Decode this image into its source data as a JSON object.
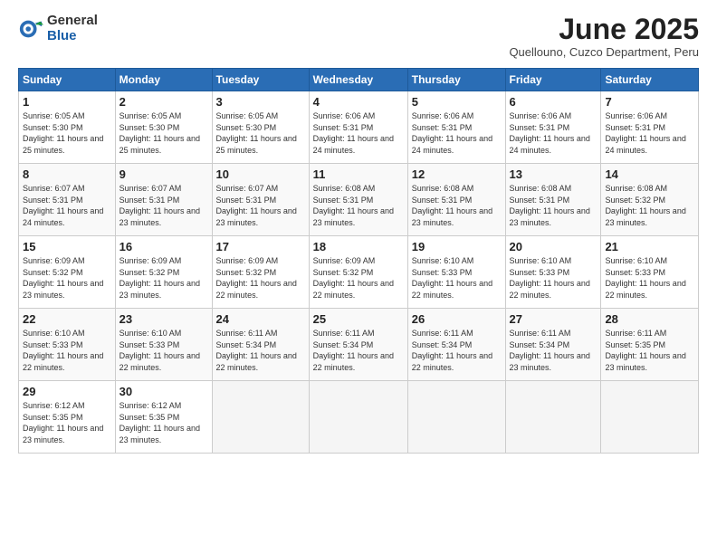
{
  "logo": {
    "general": "General",
    "blue": "Blue"
  },
  "title": "June 2025",
  "location": "Quellouno, Cuzco Department, Peru",
  "days_header": [
    "Sunday",
    "Monday",
    "Tuesday",
    "Wednesday",
    "Thursday",
    "Friday",
    "Saturday"
  ],
  "weeks": [
    [
      {
        "num": "1",
        "sunrise": "6:05 AM",
        "sunset": "5:30 PM",
        "daylight": "11 hours and 25 minutes."
      },
      {
        "num": "2",
        "sunrise": "6:05 AM",
        "sunset": "5:30 PM",
        "daylight": "11 hours and 25 minutes."
      },
      {
        "num": "3",
        "sunrise": "6:05 AM",
        "sunset": "5:30 PM",
        "daylight": "11 hours and 25 minutes."
      },
      {
        "num": "4",
        "sunrise": "6:06 AM",
        "sunset": "5:31 PM",
        "daylight": "11 hours and 24 minutes."
      },
      {
        "num": "5",
        "sunrise": "6:06 AM",
        "sunset": "5:31 PM",
        "daylight": "11 hours and 24 minutes."
      },
      {
        "num": "6",
        "sunrise": "6:06 AM",
        "sunset": "5:31 PM",
        "daylight": "11 hours and 24 minutes."
      },
      {
        "num": "7",
        "sunrise": "6:06 AM",
        "sunset": "5:31 PM",
        "daylight": "11 hours and 24 minutes."
      }
    ],
    [
      {
        "num": "8",
        "sunrise": "6:07 AM",
        "sunset": "5:31 PM",
        "daylight": "11 hours and 24 minutes."
      },
      {
        "num": "9",
        "sunrise": "6:07 AM",
        "sunset": "5:31 PM",
        "daylight": "11 hours and 23 minutes."
      },
      {
        "num": "10",
        "sunrise": "6:07 AM",
        "sunset": "5:31 PM",
        "daylight": "11 hours and 23 minutes."
      },
      {
        "num": "11",
        "sunrise": "6:08 AM",
        "sunset": "5:31 PM",
        "daylight": "11 hours and 23 minutes."
      },
      {
        "num": "12",
        "sunrise": "6:08 AM",
        "sunset": "5:31 PM",
        "daylight": "11 hours and 23 minutes."
      },
      {
        "num": "13",
        "sunrise": "6:08 AM",
        "sunset": "5:31 PM",
        "daylight": "11 hours and 23 minutes."
      },
      {
        "num": "14",
        "sunrise": "6:08 AM",
        "sunset": "5:32 PM",
        "daylight": "11 hours and 23 minutes."
      }
    ],
    [
      {
        "num": "15",
        "sunrise": "6:09 AM",
        "sunset": "5:32 PM",
        "daylight": "11 hours and 23 minutes."
      },
      {
        "num": "16",
        "sunrise": "6:09 AM",
        "sunset": "5:32 PM",
        "daylight": "11 hours and 23 minutes."
      },
      {
        "num": "17",
        "sunrise": "6:09 AM",
        "sunset": "5:32 PM",
        "daylight": "11 hours and 22 minutes."
      },
      {
        "num": "18",
        "sunrise": "6:09 AM",
        "sunset": "5:32 PM",
        "daylight": "11 hours and 22 minutes."
      },
      {
        "num": "19",
        "sunrise": "6:10 AM",
        "sunset": "5:33 PM",
        "daylight": "11 hours and 22 minutes."
      },
      {
        "num": "20",
        "sunrise": "6:10 AM",
        "sunset": "5:33 PM",
        "daylight": "11 hours and 22 minutes."
      },
      {
        "num": "21",
        "sunrise": "6:10 AM",
        "sunset": "5:33 PM",
        "daylight": "11 hours and 22 minutes."
      }
    ],
    [
      {
        "num": "22",
        "sunrise": "6:10 AM",
        "sunset": "5:33 PM",
        "daylight": "11 hours and 22 minutes."
      },
      {
        "num": "23",
        "sunrise": "6:10 AM",
        "sunset": "5:33 PM",
        "daylight": "11 hours and 22 minutes."
      },
      {
        "num": "24",
        "sunrise": "6:11 AM",
        "sunset": "5:34 PM",
        "daylight": "11 hours and 22 minutes."
      },
      {
        "num": "25",
        "sunrise": "6:11 AM",
        "sunset": "5:34 PM",
        "daylight": "11 hours and 22 minutes."
      },
      {
        "num": "26",
        "sunrise": "6:11 AM",
        "sunset": "5:34 PM",
        "daylight": "11 hours and 22 minutes."
      },
      {
        "num": "27",
        "sunrise": "6:11 AM",
        "sunset": "5:34 PM",
        "daylight": "11 hours and 23 minutes."
      },
      {
        "num": "28",
        "sunrise": "6:11 AM",
        "sunset": "5:35 PM",
        "daylight": "11 hours and 23 minutes."
      }
    ],
    [
      {
        "num": "29",
        "sunrise": "6:12 AM",
        "sunset": "5:35 PM",
        "daylight": "11 hours and 23 minutes."
      },
      {
        "num": "30",
        "sunrise": "6:12 AM",
        "sunset": "5:35 PM",
        "daylight": "11 hours and 23 minutes."
      },
      null,
      null,
      null,
      null,
      null
    ]
  ]
}
